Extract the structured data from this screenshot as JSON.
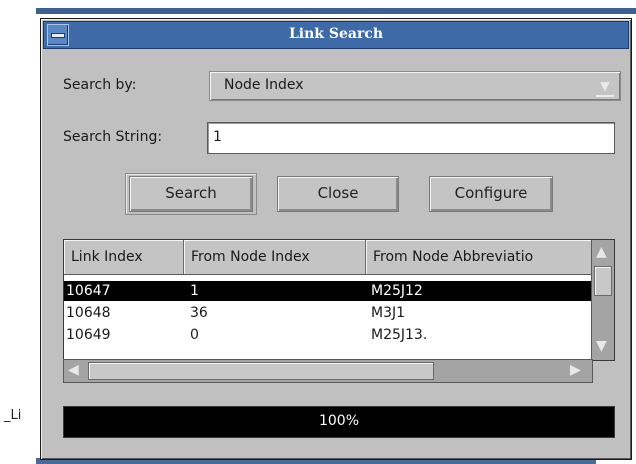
{
  "window": {
    "title": "Link Search"
  },
  "background": {
    "partial_label": "_Li"
  },
  "search_by": {
    "label": "Search by:",
    "value": "Node Index"
  },
  "search_string": {
    "label": "Search String:",
    "value": "1"
  },
  "buttons": {
    "search": "Search",
    "close": "Close",
    "configure": "Configure"
  },
  "table": {
    "columns": [
      "Link Index",
      "From Node Index",
      "From Node Abbreviatio"
    ],
    "rows": [
      {
        "link_index": "10647",
        "from_node_index": "1",
        "from_node_abbrev": "M25J12",
        "selected": true
      },
      {
        "link_index": "10648",
        "from_node_index": "36",
        "from_node_abbrev": "M3J1",
        "selected": false
      },
      {
        "link_index": "10649",
        "from_node_index": "0",
        "from_node_abbrev": "M25J13.",
        "selected": false
      }
    ]
  },
  "progress": {
    "value": 1.0,
    "text": "100%"
  },
  "icons": {
    "window_menu": "window-menu-icon",
    "combo_arrow": "dropdown-arrow-icon",
    "scroll_up": "scroll-up-icon",
    "scroll_down": "scroll-down-icon",
    "scroll_left": "scroll-left-icon",
    "scroll_right": "scroll-right-icon"
  }
}
